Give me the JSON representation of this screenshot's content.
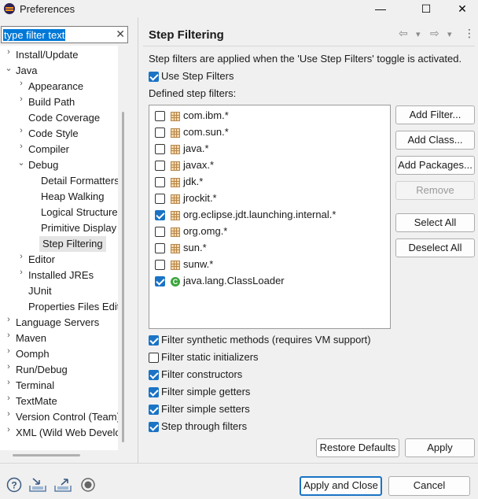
{
  "window": {
    "title": "Preferences",
    "minimize_glyph": "—",
    "maximize_glyph": "☐",
    "close_glyph": "✕"
  },
  "filter": {
    "value": "type filter text",
    "clear_glyph": "✕"
  },
  "tree": [
    {
      "label": "Install/Update",
      "twisty": "›"
    },
    {
      "label": "Java",
      "twisty": "⌄"
    },
    {
      "label": "Appearance",
      "twisty": "›"
    },
    {
      "label": "Build Path",
      "twisty": "›"
    },
    {
      "label": "Code Coverage",
      "twisty": ""
    },
    {
      "label": "Code Style",
      "twisty": "›"
    },
    {
      "label": "Compiler",
      "twisty": "›"
    },
    {
      "label": "Debug",
      "twisty": "⌄"
    },
    {
      "label": "Detail Formatters",
      "twisty": ""
    },
    {
      "label": "Heap Walking",
      "twisty": ""
    },
    {
      "label": "Logical Structures",
      "twisty": ""
    },
    {
      "label": "Primitive Display",
      "twisty": ""
    },
    {
      "label": "Step Filtering",
      "twisty": "",
      "selected": true
    },
    {
      "label": "Editor",
      "twisty": "›"
    },
    {
      "label": "Installed JREs",
      "twisty": "›"
    },
    {
      "label": "JUnit",
      "twisty": ""
    },
    {
      "label": "Properties Files Editor",
      "twisty": ""
    },
    {
      "label": "Language Servers",
      "twisty": "›"
    },
    {
      "label": "Maven",
      "twisty": "›"
    },
    {
      "label": "Oomph",
      "twisty": "›"
    },
    {
      "label": "Run/Debug",
      "twisty": "›"
    },
    {
      "label": "Terminal",
      "twisty": "›"
    },
    {
      "label": "TextMate",
      "twisty": "›"
    },
    {
      "label": "Version Control (Team)",
      "twisty": "›"
    },
    {
      "label": "XML (Wild Web Developer)",
      "twisty": "›"
    }
  ],
  "page": {
    "title": "Step Filtering",
    "nav_back": "⇦",
    "nav_forward": "⇨",
    "nav_dropdown": "▾",
    "menu": "⋮",
    "description": "Step filters are applied when the 'Use Step Filters' toggle is activated.",
    "use_step_filters": {
      "label": "Use Step Filters",
      "checked": true
    },
    "defined_label": "Defined step filters:",
    "filters": [
      {
        "label": "com.ibm.*",
        "checked": false,
        "icon": "package"
      },
      {
        "label": "com.sun.*",
        "checked": false,
        "icon": "package"
      },
      {
        "label": "java.*",
        "checked": false,
        "icon": "package"
      },
      {
        "label": "javax.*",
        "checked": false,
        "icon": "package"
      },
      {
        "label": "jdk.*",
        "checked": false,
        "icon": "package"
      },
      {
        "label": "jrockit.*",
        "checked": false,
        "icon": "package"
      },
      {
        "label": "org.eclipse.jdt.launching.internal.*",
        "checked": true,
        "icon": "package"
      },
      {
        "label": "org.omg.*",
        "checked": false,
        "icon": "package"
      },
      {
        "label": "sun.*",
        "checked": false,
        "icon": "package"
      },
      {
        "label": "sunw.*",
        "checked": false,
        "icon": "package"
      },
      {
        "label": "java.lang.ClassLoader",
        "checked": true,
        "icon": "class"
      }
    ],
    "class_icon_letter": "C",
    "buttons": {
      "add_filter": "Add Filter...",
      "add_class": "Add Class...",
      "add_packages": "Add Packages...",
      "remove": "Remove",
      "select_all": "Select All",
      "deselect_all": "Deselect All"
    },
    "options": [
      {
        "label": "Filter synthetic methods (requires VM support)",
        "checked": true
      },
      {
        "label": "Filter static initializers",
        "checked": false
      },
      {
        "label": "Filter constructors",
        "checked": true
      },
      {
        "label": "Filter simple getters",
        "checked": true
      },
      {
        "label": "Filter simple setters",
        "checked": true
      },
      {
        "label": "Step through filters",
        "checked": true
      }
    ],
    "restore_defaults": "Restore Defaults",
    "apply": "Apply"
  },
  "footer": {
    "help_glyph": "?",
    "apply_and_close": "Apply and Close",
    "cancel": "Cancel"
  },
  "colors": {
    "accent": "#1a73c5",
    "selection": "#0078d7"
  }
}
